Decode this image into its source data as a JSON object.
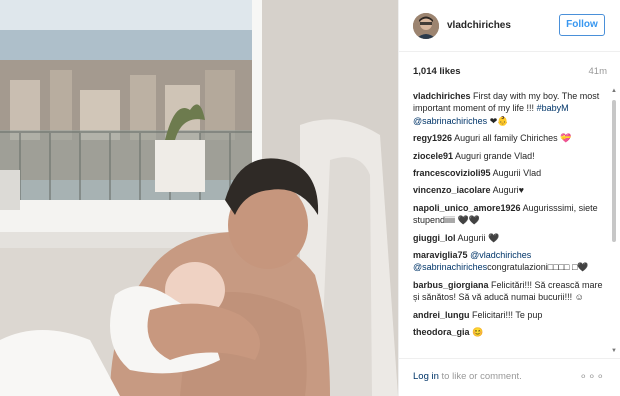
{
  "post": {
    "username": "vladchiriches",
    "follow_label": "Follow",
    "likes": "1,014 likes",
    "time": "41m",
    "caption_user": "vladchiriches",
    "caption_text": "First day with my boy. The most important moment of my life !!!",
    "caption_tags": "#babyM @sabrinachiriches",
    "caption_emoji": "❤👶"
  },
  "comments": [
    {
      "user": "regy1926",
      "text": "Auguri all family Chiriches 💝"
    },
    {
      "user": "ziocele91",
      "text": "Auguri grande Vlad!"
    },
    {
      "user": "francescovizioli95",
      "text": "Augurii Vlad"
    },
    {
      "user": "vincenzo_iacolare",
      "text": "Auguri♥"
    },
    {
      "user": "napoli_unico_amore1926",
      "text": "Augurisssimi, siete stupendiiiii 🖤🖤"
    },
    {
      "user": "giuggi_lol",
      "text": "Augurii 🖤"
    },
    {
      "user": "maraviglia75",
      "tags": "@vladchiriches @sabrinachiriches",
      "tag2": "congratulazioni",
      "text": "□□□□ □🖤"
    },
    {
      "user": "barbus_giorgiana",
      "text": "Felicitări!!! Să crească mare și sănătos! Să vă aducă numai bucurii!!! ☺"
    },
    {
      "user": "andrei_lungu",
      "text": "Felicitari!!! Te pup"
    },
    {
      "user": "theodora_gia",
      "text": "😊"
    }
  ],
  "footer": {
    "login_link": "Log in",
    "login_rest": " to like or comment.",
    "more_icon": "more-dots-icon",
    "more_glyph": "∘∘∘"
  },
  "scroll": {
    "up": "▲",
    "down": "▼"
  }
}
